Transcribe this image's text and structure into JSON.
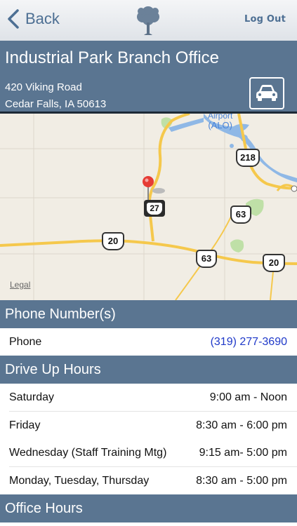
{
  "topbar": {
    "back_label": "Back",
    "logout_label": "Log Out"
  },
  "branch": {
    "name": "Industrial Park Branch Office",
    "address_line1": "420 Viking Road",
    "address_line2": "Cedar Falls, IA 50613"
  },
  "map": {
    "airport_label_1": "Airport",
    "airport_label_2": "(ALO)",
    "shields": [
      "218",
      "27",
      "63",
      "20",
      "63",
      "20"
    ],
    "legal_label": "Legal"
  },
  "phone_section": {
    "title": "Phone Number(s)",
    "rows": [
      {
        "label": "Phone",
        "value": "(319) 277-3690"
      }
    ]
  },
  "drive_up_section": {
    "title": "Drive Up Hours",
    "rows": [
      {
        "label": "Saturday",
        "value": "9:00 am - Noon"
      },
      {
        "label": "Friday",
        "value": "8:30 am - 6:00 pm"
      },
      {
        "label": "Wednesday (Staff Training Mtg)",
        "value": "9:15 am- 5:00 pm"
      },
      {
        "label": "Monday, Tuesday, Thursday",
        "value": "8:30 am - 5:00 pm"
      }
    ]
  },
  "office_section": {
    "title": "Office Hours"
  },
  "colors": {
    "header": "#5a7591",
    "link": "#1f39c9",
    "road": "#f5c84c",
    "water": "#8fb8e6"
  }
}
